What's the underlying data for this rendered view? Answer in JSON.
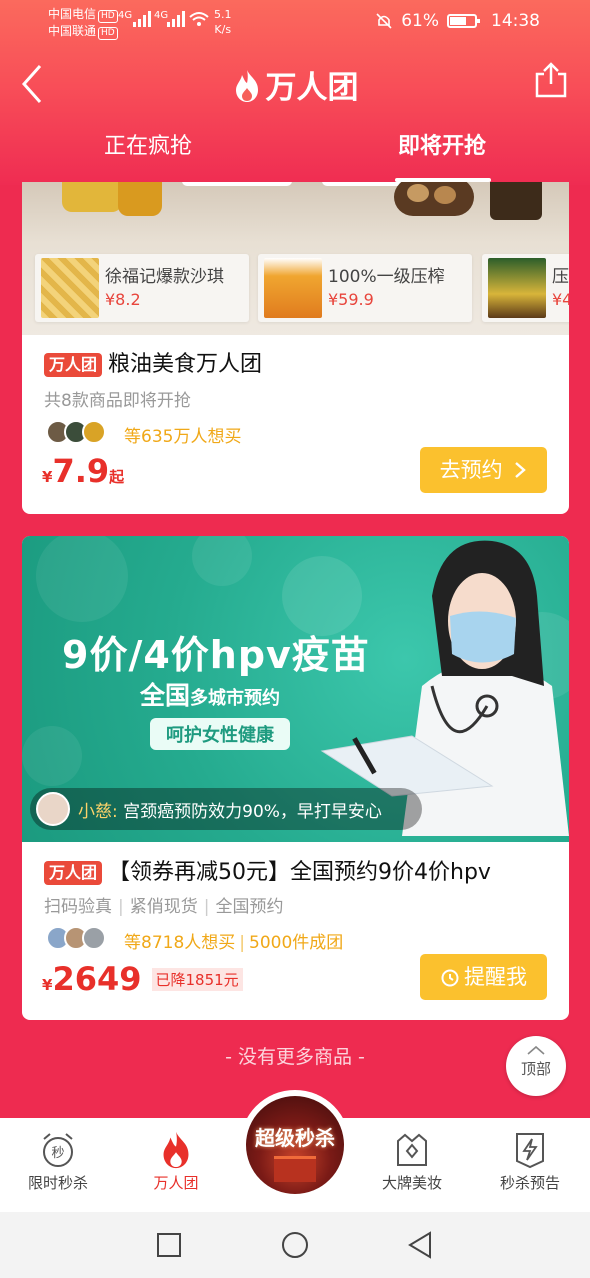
{
  "status_bar": {
    "carrier1": "中国电信",
    "carrier2": "中国联通",
    "hd": "HD",
    "signal1": "4G",
    "signal2": "4G",
    "speed_value": "5.1",
    "speed_unit": "K/s",
    "battery": "61%",
    "time": "14:38"
  },
  "header": {
    "title": "万人团"
  },
  "tabs": [
    {
      "label": "正在疯抢",
      "active": false
    },
    {
      "label": "即将开抢",
      "active": true
    }
  ],
  "card1": {
    "mini_items": [
      {
        "name": "徐福记爆款沙琪",
        "price": "¥8.2"
      },
      {
        "name": "100%一级压榨",
        "price": "¥59.9"
      },
      {
        "name": "压",
        "price": "¥4"
      }
    ],
    "badge": "万人团",
    "title": "粮油美食万人团",
    "subtitle": "共8款商品即将开抢",
    "want": "等635万人想买",
    "price_symbol": "¥",
    "price": "7.9",
    "price_suffix": "起",
    "cta": "去预约"
  },
  "card2": {
    "banner_title": "9价/4价hpv疫苗",
    "banner_big": "全国",
    "banner_small": "多城市预约",
    "banner_pill": "呵护女性健康",
    "ticker_user": "小慈:",
    "ticker_text": "宫颈癌预防效力90%，早打早安心",
    "badge": "万人团",
    "title": "【领券再减50元】全国预约9价4价hpv",
    "tags": [
      "扫码验真",
      "紧俏现货",
      "全国预约"
    ],
    "want": "等8718人想买",
    "group": "5000件成团",
    "price_symbol": "¥",
    "price": "2649",
    "drop": "已降1851元",
    "cta": "提醒我"
  },
  "footer_text": "- 没有更多商品 -",
  "top_button": "顶部",
  "bottom_nav": {
    "items": [
      {
        "label": "限时秒杀",
        "icon": "alarm-clock-icon"
      },
      {
        "label": "万人团",
        "icon": "flame-icon"
      },
      {
        "label": "大牌美妆",
        "icon": "crown-icon"
      },
      {
        "label": "秒杀预告",
        "icon": "lightning-icon"
      }
    ],
    "center": "超级秒杀"
  },
  "colors": {
    "primary_red": "#ee2b50",
    "price_red": "#e8302a",
    "cta_yellow": "#fbc12e",
    "banner_teal": "#25ab8f"
  }
}
